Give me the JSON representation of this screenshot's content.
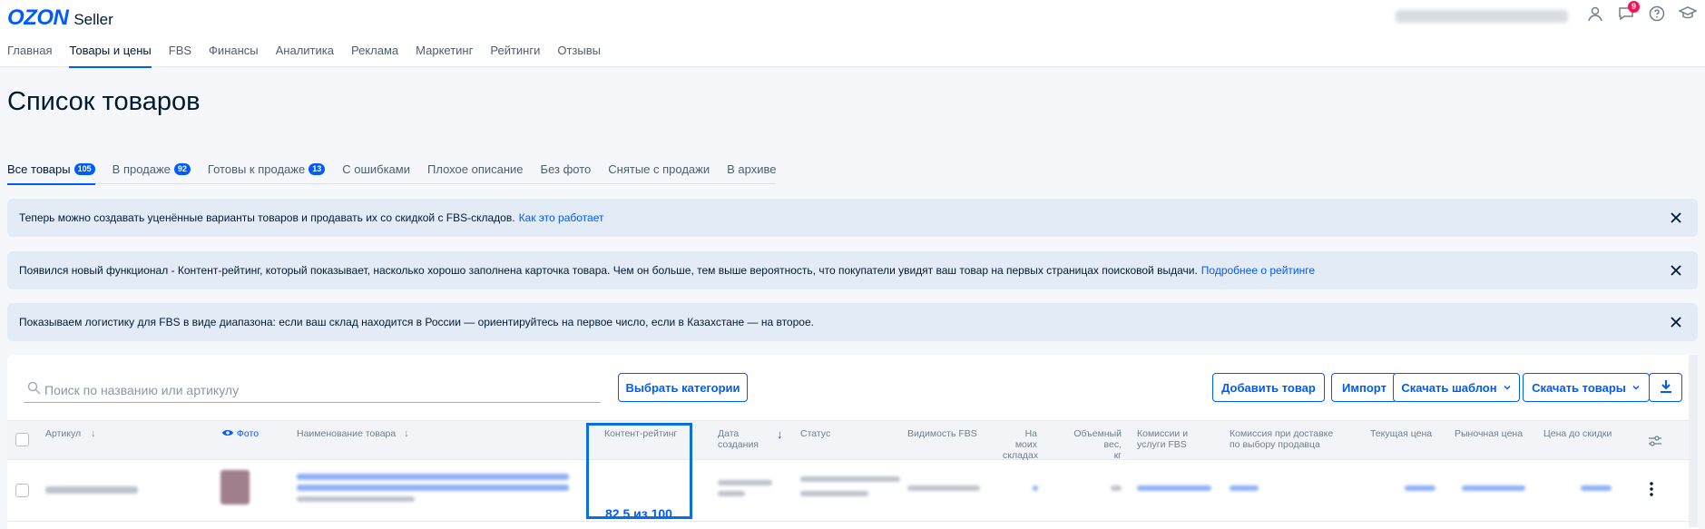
{
  "header": {
    "brand": "OZON",
    "product": "Seller",
    "icons": [
      "user-icon",
      "chat-icon",
      "help-icon",
      "education-icon"
    ],
    "notifications_count": "9"
  },
  "nav": {
    "items": [
      "Главная",
      "Товары и цены",
      "FBS",
      "Финансы",
      "Аналитика",
      "Реклама",
      "Маркетинг",
      "Рейтинги",
      "Отзывы"
    ]
  },
  "page": {
    "title": "Список товаров"
  },
  "tabs": [
    {
      "label": "Все товары",
      "count": "105"
    },
    {
      "label": "В продаже",
      "count": "92"
    },
    {
      "label": "Готовы к продаже",
      "count": "13"
    },
    {
      "label": "С ошибками",
      "count": ""
    },
    {
      "label": "Плохое описание",
      "count": ""
    },
    {
      "label": "Без фото",
      "count": ""
    },
    {
      "label": "Снятые с продажи",
      "count": ""
    },
    {
      "label": "В архиве",
      "count": ""
    }
  ],
  "banners": [
    {
      "text": "Теперь можно создавать уценённые варианты товаров и продавать их со скидкой с FBS-складов.",
      "link": "Как это работает"
    },
    {
      "text": "Появился новый функционал - Контент-рейтинг, который показывает, насколько хорошо заполнена карточка товара. Чем он больше, тем выше вероятность, что покупатели увидят ваш товар на первых страницах поисковой выдачи.",
      "link": "Подробнее о рейтинге"
    },
    {
      "text": "Показываем логистику для FBS в виде диапазона: если ваш склад находится в России — ориентируйтесь на первое число, если в Казахстане — на второе.",
      "link": ""
    }
  ],
  "toolbar": {
    "search_placeholder": "Поиск по названию или артикулу",
    "choose_categories": "Выбрать категории",
    "add_product": "Добавить товар",
    "import": "Импорт",
    "download_template": "Скачать шаблон",
    "download_products": "Скачать товары"
  },
  "table": {
    "columns": {
      "article": "Артикул",
      "photo": "Фото",
      "name": "Наименование товара",
      "content_rating": "Контент-рейтинг",
      "created_1": "Дата",
      "created_2": "создания",
      "status": "Статус",
      "fbs_visibility": "Видимость FBS",
      "warehouses_1": "На моих",
      "warehouses_2": "складах",
      "volume_1": "Объемный вес,",
      "volume_2": "кг",
      "commission_1": "Комиссии и",
      "commission_2": "услуги FBS",
      "delivery_1": "Комиссия при доставке",
      "delivery_2": "по выбору продавца",
      "current_price": "Текущая цена",
      "market_price": "Рыночная цена",
      "price_before": "Цена до скидки"
    },
    "rows": [
      {
        "content_rating": "82.5 из 100"
      }
    ]
  },
  "colors": {
    "accent": "#005bff",
    "banner_bg": "#e3ebf7",
    "highlight": "#0a6fe0"
  }
}
